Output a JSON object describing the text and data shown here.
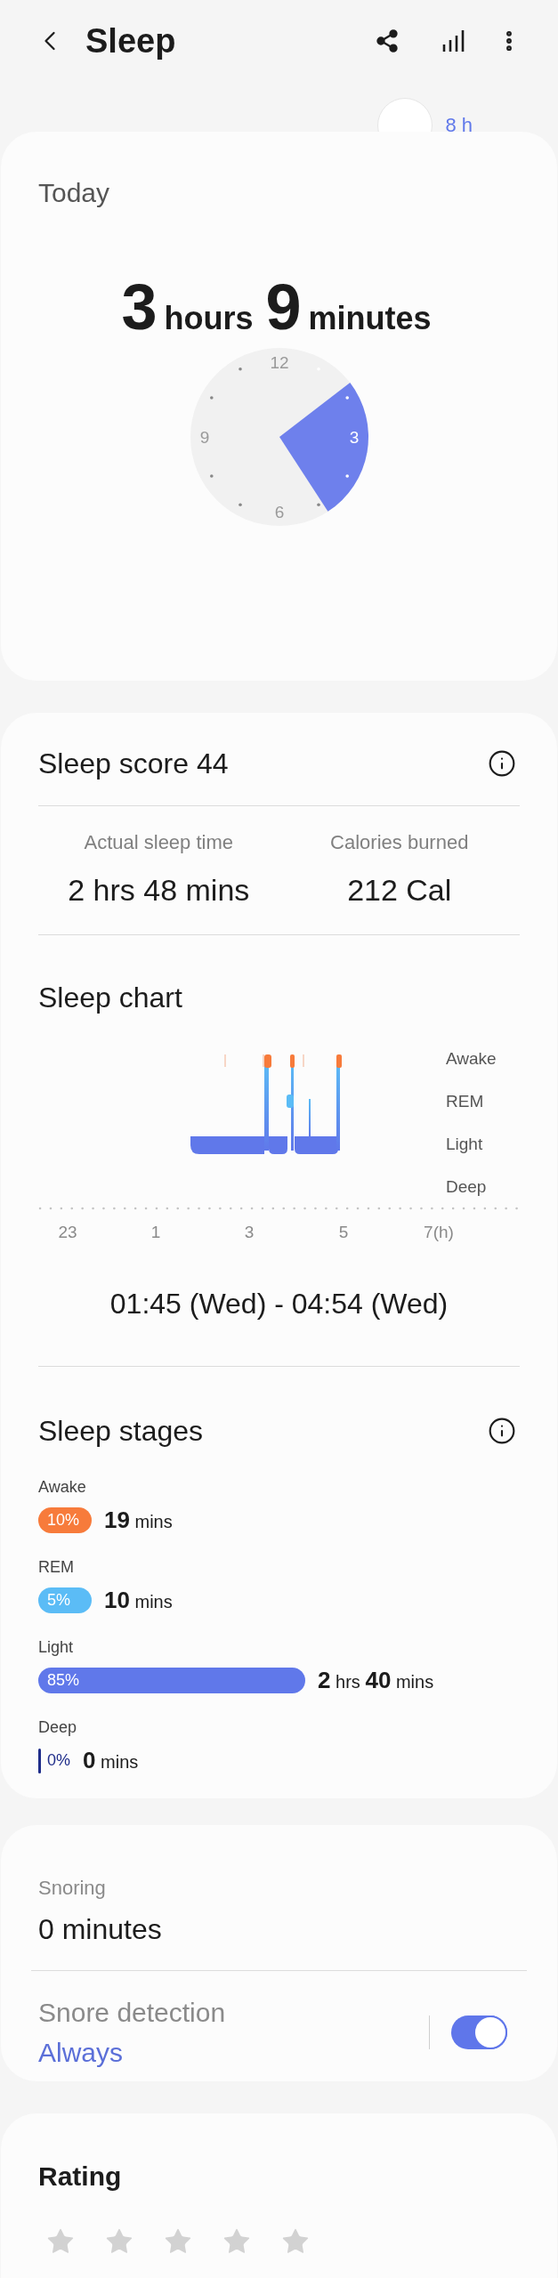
{
  "header": {
    "title": "Sleep"
  },
  "goal": {
    "label": "8 h"
  },
  "today": {
    "title": "Today",
    "duration": [
      {
        "text": "3",
        "kind": "number"
      },
      {
        "text": "hours",
        "kind": "unit"
      },
      {
        "text": "9",
        "kind": "number"
      },
      {
        "text": "minutes",
        "kind": "unit"
      }
    ],
    "clock_labels": [
      "12",
      "3",
      "6",
      "9"
    ]
  },
  "score": {
    "title": "Sleep score 44",
    "stats": [
      {
        "label": "Actual sleep time",
        "value": "2 hrs 48 mins"
      },
      {
        "label": "Calories burned",
        "value": "212 Cal"
      }
    ]
  },
  "sleep_chart": {
    "title": "Sleep chart",
    "stage_labels": [
      "Awake",
      "REM",
      "Light",
      "Deep"
    ],
    "x_labels": [
      "23",
      "1",
      "3",
      "5",
      "7(h)"
    ],
    "time_range": "01:45 (Wed) - 04:54 (Wed)"
  },
  "sleep_stages": {
    "title": "Sleep stages",
    "stages": [
      {
        "name": "Awake",
        "percent": "10%",
        "color": "#f77b3b",
        "duration": "**19** mins"
      },
      {
        "name": "REM",
        "percent": "5%",
        "color": "#5bbcf6",
        "duration": "**10** mins"
      },
      {
        "name": "Light",
        "percent": "85%",
        "color": "#6078ea",
        "duration": "**2** hrs **40** mins"
      },
      {
        "name": "Deep",
        "percent": "0%",
        "color": "#1f2d8a",
        "duration": "**0** mins"
      }
    ]
  },
  "snoring": {
    "label": "Snoring",
    "value": "0 minutes",
    "detection": {
      "label": "Snore detection",
      "value": "Always",
      "on": true
    }
  },
  "rating": {
    "title": "Rating",
    "stars": 0
  }
}
